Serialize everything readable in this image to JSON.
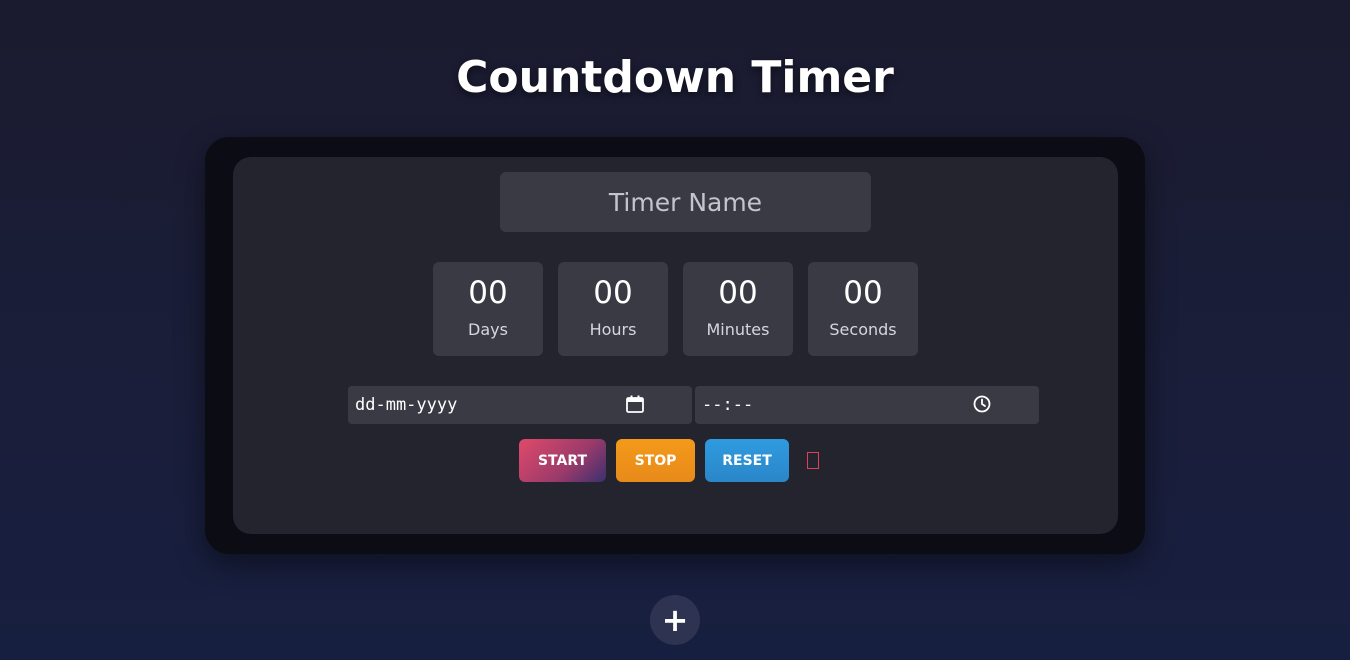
{
  "page": {
    "title": "Countdown Timer"
  },
  "timer": {
    "name_placeholder": "Timer Name",
    "units": [
      {
        "value": "00",
        "label": "Days"
      },
      {
        "value": "00",
        "label": "Hours"
      },
      {
        "value": "00",
        "label": "Minutes"
      },
      {
        "value": "00",
        "label": "Seconds"
      }
    ],
    "date_placeholder": "dd-mm-yyyy",
    "time_placeholder": "--:--",
    "date_icon": "calendar-icon",
    "time_icon": "clock-icon",
    "buttons": {
      "start": "START",
      "stop": "STOP",
      "reset": "RESET"
    },
    "delete_icon": "delete-icon"
  },
  "add_button": {
    "label": "+"
  },
  "colors": {
    "background": "#1b1b2f",
    "card_outer": "#0c0c15",
    "card_inner": "#24242f",
    "field": "#3a3a45",
    "start_accent": "#e04a6a",
    "stop_accent": "#f39a1a",
    "reset_accent": "#2f9be0",
    "delete_accent": "#e0405a"
  }
}
